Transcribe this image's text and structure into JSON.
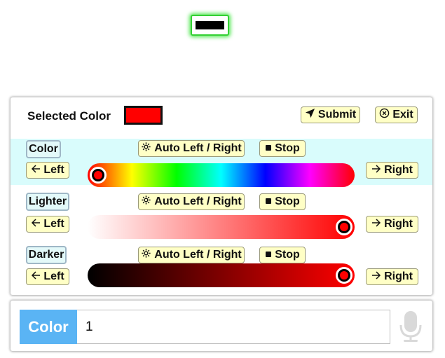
{
  "preview": {
    "color": "#000000"
  },
  "header": {
    "selected_label": "Selected Color",
    "selected_color": "#ff0000",
    "submit_label": "Submit",
    "exit_label": "Exit"
  },
  "rows": [
    {
      "id": "color",
      "tag": "Color",
      "auto_label": "Auto Left / Right",
      "stop_label": "Stop",
      "left_label": "Left",
      "right_label": "Right",
      "knob_color": "#ff0000",
      "knob_position": 0.04
    },
    {
      "id": "lighter",
      "tag": "Lighter",
      "auto_label": "Auto Left / Right",
      "stop_label": "Stop",
      "left_label": "Left",
      "right_label": "Right",
      "knob_color": "#ff0000",
      "knob_position": 0.96
    },
    {
      "id": "darker",
      "tag": "Darker",
      "auto_label": "Auto Left / Right",
      "stop_label": "Stop",
      "left_label": "Left",
      "right_label": "Right",
      "knob_color": "#ff0000",
      "knob_position": 0.96
    }
  ],
  "input": {
    "label": "Color",
    "value": "1"
  },
  "icons": {
    "submit": "send-icon",
    "exit": "close-circle-icon",
    "auto": "gear-icon",
    "stop": "stop-square-icon",
    "left": "arrow-left-icon",
    "right": "arrow-right-icon",
    "mic": "microphone-icon"
  },
  "colors": {
    "button_bg": "#ffffc6",
    "tag_bg": "#e3f9f9",
    "highlight_band": "#d9fcfc",
    "input_label_bg": "#5ab4f4"
  }
}
